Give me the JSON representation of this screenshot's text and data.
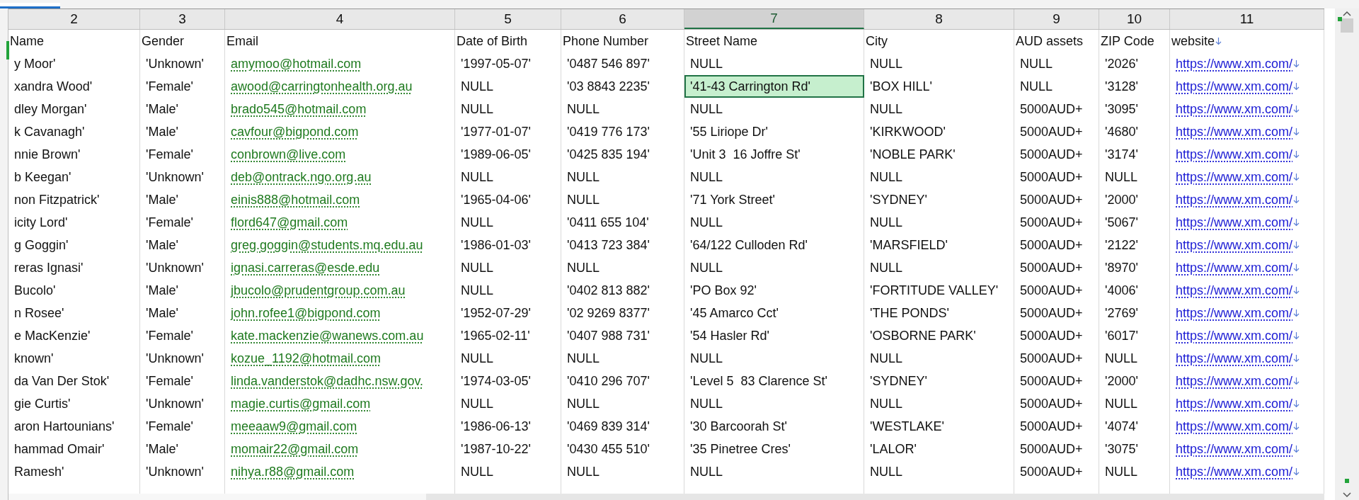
{
  "columns": [
    {
      "number": "2",
      "heading": "Name",
      "kind": "text",
      "selected": false
    },
    {
      "number": "3",
      "heading": "Gender",
      "kind": "text",
      "selected": false
    },
    {
      "number": "4",
      "heading": "Email",
      "kind": "email",
      "selected": false
    },
    {
      "number": "5",
      "heading": "Date of Birth",
      "kind": "text",
      "selected": false
    },
    {
      "number": "6",
      "heading": "Phone Number",
      "kind": "text",
      "selected": false
    },
    {
      "number": "7",
      "heading": "Street Name",
      "kind": "text",
      "selected": true
    },
    {
      "number": "8",
      "heading": "City",
      "kind": "text",
      "selected": false
    },
    {
      "number": "9",
      "heading": "AUD assets",
      "kind": "text",
      "selected": false
    },
    {
      "number": "10",
      "heading": "ZIP Code",
      "kind": "text",
      "selected": false
    },
    {
      "number": "11",
      "heading": "website",
      "kind": "url",
      "selected": false
    }
  ],
  "rows": [
    {
      "selected": false,
      "cells": [
        "y Moor'",
        "'Unknown'",
        "amymoo@hotmail.com",
        "'1997-05-07'",
        "'0487 546 897'",
        "NULL",
        "NULL",
        "NULL",
        "'2026'",
        "https://www.xm.com/"
      ]
    },
    {
      "selected": true,
      "cells": [
        "xandra Wood'",
        "'Female'",
        "awood@carringtonhealth.org.au",
        "NULL",
        "'03 8843 2235'",
        "'41-43 Carrington Rd'",
        "'BOX HILL'",
        "NULL",
        "'3128'",
        "https://www.xm.com/"
      ]
    },
    {
      "selected": false,
      "cells": [
        "dley Morgan'",
        "'Male'",
        "brado545@hotmail.com",
        "NULL",
        "NULL",
        "NULL",
        "NULL",
        "5000AUD+",
        "'3095'",
        "https://www.xm.com/"
      ]
    },
    {
      "selected": false,
      "cells": [
        "k Cavanagh'",
        "'Male'",
        "cavfour@bigpond.com",
        "'1977-01-07'",
        "'0419 776 173'",
        "'55 Liriope Dr'",
        "'KIRKWOOD'",
        "5000AUD+",
        "'4680'",
        "https://www.xm.com/"
      ]
    },
    {
      "selected": false,
      "cells": [
        "nnie Brown'",
        "'Female'",
        "conbrown@live.com",
        "'1989-06-05'",
        "'0425 835 194'",
        "'Unit 3  16 Joffre St'",
        "'NOBLE PARK'",
        "5000AUD+",
        "'3174'",
        "https://www.xm.com/"
      ]
    },
    {
      "selected": false,
      "cells": [
        "b Keegan'",
        "'Unknown'",
        "deb@ontrack.ngo.org.au",
        "NULL",
        "NULL",
        "NULL",
        "NULL",
        "5000AUD+",
        "NULL",
        "https://www.xm.com/"
      ]
    },
    {
      "selected": false,
      "cells": [
        "non Fitzpatrick'",
        "'Male'",
        "einis888@hotmail.com",
        "'1965-04-06'",
        "NULL",
        "'71 York Street'",
        "'SYDNEY'",
        "5000AUD+",
        "'2000'",
        "https://www.xm.com/"
      ]
    },
    {
      "selected": false,
      "cells": [
        "icity Lord'",
        "'Female'",
        "flord647@gmail.com",
        "NULL",
        "'0411 655 104'",
        "NULL",
        "NULL",
        "5000AUD+",
        "'5067'",
        "https://www.xm.com/"
      ]
    },
    {
      "selected": false,
      "cells": [
        "g Goggin'",
        "'Male'",
        "greg.goggin@students.mq.edu.au",
        "'1986-01-03'",
        "'0413 723 384'",
        "'64/122 Culloden Rd'",
        "'MARSFIELD'",
        "5000AUD+",
        "'2122'",
        "https://www.xm.com/"
      ]
    },
    {
      "selected": false,
      "cells": [
        "reras Ignasi'",
        "'Unknown'",
        "ignasi.carreras@esde.edu",
        "NULL",
        "NULL",
        "NULL",
        "NULL",
        "5000AUD+",
        "'8970'",
        "https://www.xm.com/"
      ]
    },
    {
      "selected": false,
      "cells": [
        "Bucolo'",
        "'Male'",
        "jbucolo@prudentgroup.com.au",
        "NULL",
        "'0402 813 882'",
        "'PO Box 92'",
        "'FORTITUDE VALLEY'",
        "5000AUD+",
        "'4006'",
        "https://www.xm.com/"
      ]
    },
    {
      "selected": false,
      "cells": [
        "n Rosee'",
        "'Male'",
        "john.rofee1@bigpond.com",
        "'1952-07-29'",
        "'02 9269 8377'",
        "'45 Amarco Cct'",
        "'THE PONDS'",
        "5000AUD+",
        "'2769'",
        "https://www.xm.com/"
      ]
    },
    {
      "selected": false,
      "cells": [
        "e MacKenzie'",
        "'Female'",
        "kate.mackenzie@wanews.com.au",
        "'1965-02-11'",
        "'0407 988 731'",
        "'54 Hasler Rd'",
        "'OSBORNE PARK'",
        "5000AUD+",
        "'6017'",
        "https://www.xm.com/"
      ]
    },
    {
      "selected": false,
      "cells": [
        "known'",
        "'Unknown'",
        "kozue_1192@hotmail.com",
        "NULL",
        "NULL",
        "NULL",
        "NULL",
        "5000AUD+",
        "NULL",
        "https://www.xm.com/"
      ]
    },
    {
      "selected": false,
      "cells": [
        "da Van Der Stok'",
        "'Female'",
        "linda.vanderstok@dadhc.nsw.gov.",
        "'1974-03-05'",
        "'0410 296 707'",
        "'Level 5  83 Clarence St'",
        "'SYDNEY'",
        "5000AUD+",
        "'2000'",
        "https://www.xm.com/"
      ]
    },
    {
      "selected": false,
      "cells": [
        "gie Curtis'",
        "'Unknown'",
        "magie.curtis@gmail.com",
        "NULL",
        "NULL",
        "NULL",
        "NULL",
        "5000AUD+",
        "NULL",
        "https://www.xm.com/"
      ]
    },
    {
      "selected": false,
      "cells": [
        "aron Hartounians'",
        "'Female'",
        "meeaaw9@gmail.com",
        "'1986-06-13'",
        "'0469 839 314'",
        "'30 Barcoorah St'",
        "'WESTLAKE'",
        "5000AUD+",
        "'4074'",
        "https://www.xm.com/"
      ]
    },
    {
      "selected": false,
      "cells": [
        "hammad Omair'",
        "'Male'",
        "momair22@gmail.com",
        "'1987-10-22'",
        "'0430 455 510'",
        "'35 Pinetree Cres'",
        "'LALOR'",
        "5000AUD+",
        "'3075'",
        "https://www.xm.com/"
      ]
    },
    {
      "selected": false,
      "cells": [
        "Ramesh'",
        "'Unknown'",
        "nihya.r88@gmail.com",
        "NULL",
        "NULL",
        "NULL",
        "NULL",
        "5000AUD+",
        "NULL",
        "https://www.xm.com/"
      ]
    }
  ]
}
